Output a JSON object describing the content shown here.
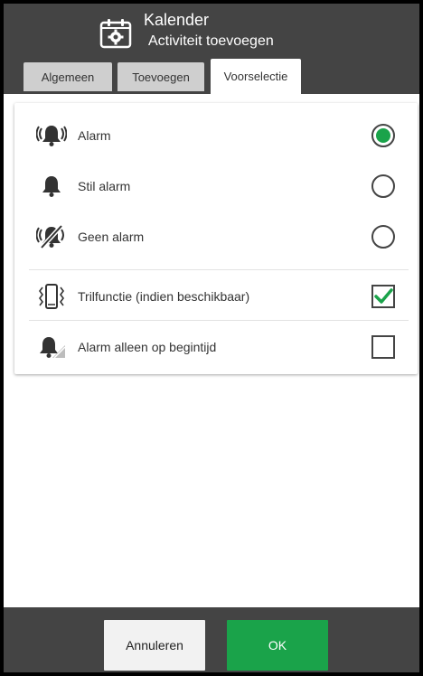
{
  "header": {
    "title": "Kalender",
    "subtitle": "Activiteit toevoegen",
    "icon": "calendar-gear-icon"
  },
  "tabs": [
    {
      "label": "Algemeen",
      "active": false
    },
    {
      "label": "Toevoegen",
      "active": false
    },
    {
      "label": "Voorselectie",
      "active": true
    }
  ],
  "options": {
    "alarm_mode": {
      "selected": "Alarm",
      "items": [
        {
          "label": "Alarm",
          "icon": "ringing-bell-icon",
          "checked": true
        },
        {
          "label": "Stil alarm",
          "icon": "bell-icon",
          "checked": false
        },
        {
          "label": "Geen alarm",
          "icon": "bell-off-icon",
          "checked": false
        }
      ]
    },
    "toggles": [
      {
        "label": "Trilfunctie (indien beschikbaar)",
        "icon": "vibrate-phone-icon",
        "checked": true
      },
      {
        "label": "Alarm alleen op begintijd",
        "icon": "bell-start-icon",
        "checked": false
      }
    ]
  },
  "footer": {
    "cancel_label": "Annuleren",
    "ok_label": "OK"
  },
  "colors": {
    "accent": "#1aa34a",
    "header_bg": "#444444",
    "tab_inactive": "#cfcfcf"
  }
}
